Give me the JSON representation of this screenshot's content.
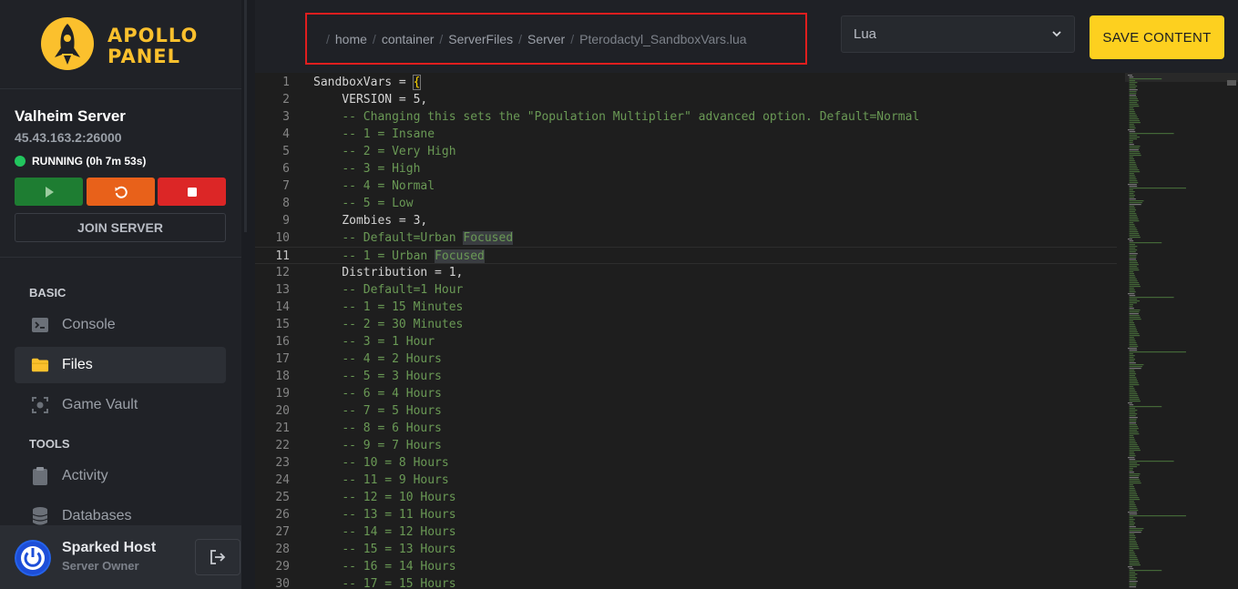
{
  "brand": {
    "line1": "APOLLO",
    "line2": "PANEL",
    "accent": "#fbc02d"
  },
  "server": {
    "name": "Valheim Server",
    "address": "45.43.163.2:26000",
    "status": "RUNNING (0h 7m 53s)",
    "status_color": "#22c55e",
    "join_label": "JOIN SERVER"
  },
  "controls": {
    "start_icon": "play-icon",
    "restart_icon": "restart-icon",
    "stop_icon": "stop-icon"
  },
  "nav": {
    "basic_label": "BASIC",
    "tools_label": "TOOLS",
    "console": "Console",
    "files": "Files",
    "game_vault": "Game Vault",
    "activity": "Activity",
    "databases": "Databases"
  },
  "user": {
    "name": "Sparked Host",
    "role": "Server Owner"
  },
  "breadcrumb": {
    "items": [
      "home",
      "container",
      "ServerFiles",
      "Server"
    ],
    "file": "Pterodactyl_SandboxVars.lua"
  },
  "language": {
    "selected": "Lua"
  },
  "save_label": "SAVE CONTENT",
  "editor": {
    "current_line": 11,
    "lines": [
      "SandboxVars = {",
      "    VERSION = 5,",
      "    -- Changing this sets the \"Population Multiplier\" advanced option. Default=Normal",
      "    -- 1 = Insane",
      "    -- 2 = Very High",
      "    -- 3 = High",
      "    -- 4 = Normal",
      "    -- 5 = Low",
      "    Zombies = 3,",
      "    -- Default=Urban Focused",
      "    -- 1 = Urban Focused",
      "    Distribution = 1,",
      "    -- Default=1 Hour",
      "    -- 1 = 15 Minutes",
      "    -- 2 = 30 Minutes",
      "    -- 3 = 1 Hour",
      "    -- 4 = 2 Hours",
      "    -- 5 = 3 Hours",
      "    -- 6 = 4 Hours",
      "    -- 7 = 5 Hours",
      "    -- 8 = 6 Hours",
      "    -- 9 = 7 Hours",
      "    -- 10 = 8 Hours",
      "    -- 11 = 9 Hours",
      "    -- 12 = 10 Hours",
      "    -- 13 = 11 Hours",
      "    -- 14 = 12 Hours",
      "    -- 15 = 13 Hours",
      "    -- 16 = 14 Hours",
      "    -- 17 = 15 Hours"
    ]
  }
}
